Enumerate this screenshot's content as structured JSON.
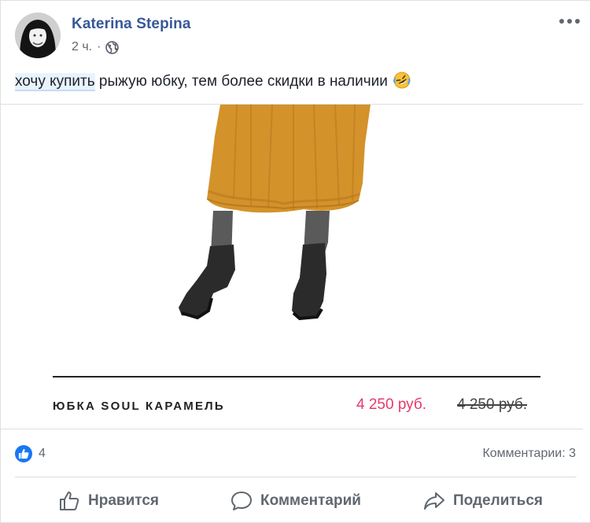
{
  "post": {
    "author": "Katerina Stepina",
    "time": "2 ч.",
    "separator": "·",
    "text_highlight": "хочу купить",
    "text_rest": " рыжую юбку, тем более скидки в наличии",
    "emoji": "rolling-on-floor-laughing-emoji"
  },
  "product": {
    "name": "ЮБКА SOUL КАРАМЕЛЬ",
    "price_new": "4 250 руб.",
    "price_old": "4 250 руб.",
    "skirt_color": "#d4922a",
    "price_color": "#e6386b"
  },
  "stats": {
    "reactions_count": "4",
    "comments": "Комментарии: 3"
  },
  "actions": {
    "like": "Нравится",
    "comment": "Комментарий",
    "share": "Поделиться"
  },
  "colors": {
    "author": "#385898",
    "like_badge": "#1877f2",
    "secondary_text": "#606770"
  }
}
